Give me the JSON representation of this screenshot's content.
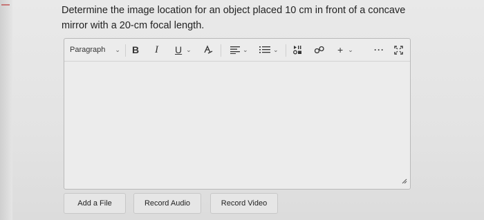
{
  "question": {
    "text": "Determine the image location for an object placed 10 cm in front of a concave mirror with a 20-cm focal length."
  },
  "editor": {
    "toolbar": {
      "paragraph_select": "Paragraph",
      "bold": "B",
      "italic": "I",
      "underline": "U",
      "add": "+",
      "more": "···"
    },
    "body_text": ""
  },
  "actions": {
    "add_file": "Add a File",
    "record_audio": "Record Audio",
    "record_video": "Record Video"
  },
  "icons": [
    "text-color-icon",
    "align-icon",
    "list-icon",
    "media-icon",
    "link-icon",
    "fullscreen-icon",
    "resize-handle-icon"
  ]
}
